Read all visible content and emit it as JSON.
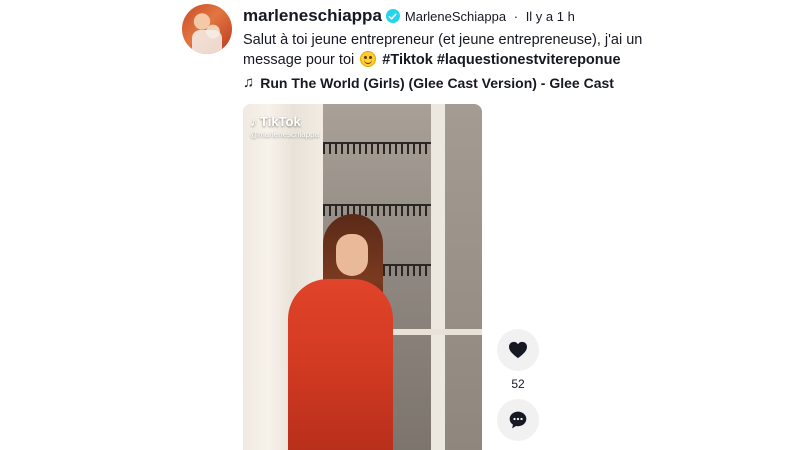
{
  "post": {
    "username": "marleneschiappa",
    "display_name": "MarleneSchiappa",
    "separator": "·",
    "time": "Il y a 1 h",
    "caption_text": "Salut à toi jeune entrepreneur (et jeune entrepreneuse), j'ai un message pour toi",
    "hashtags": [
      "#Tiktok",
      "#laquestionestvitereponue"
    ],
    "music_icon": "♫",
    "music": "Run The World (Girls) (Glee Cast Version) - Glee Cast"
  },
  "video": {
    "brand": "TikTok",
    "brand_icon": "♪",
    "handle": "@marleneschiappa"
  },
  "actions": {
    "likes": "52"
  },
  "colors": {
    "verified": "#20d5ec",
    "text": "#161823",
    "dress": "#d23a22"
  }
}
